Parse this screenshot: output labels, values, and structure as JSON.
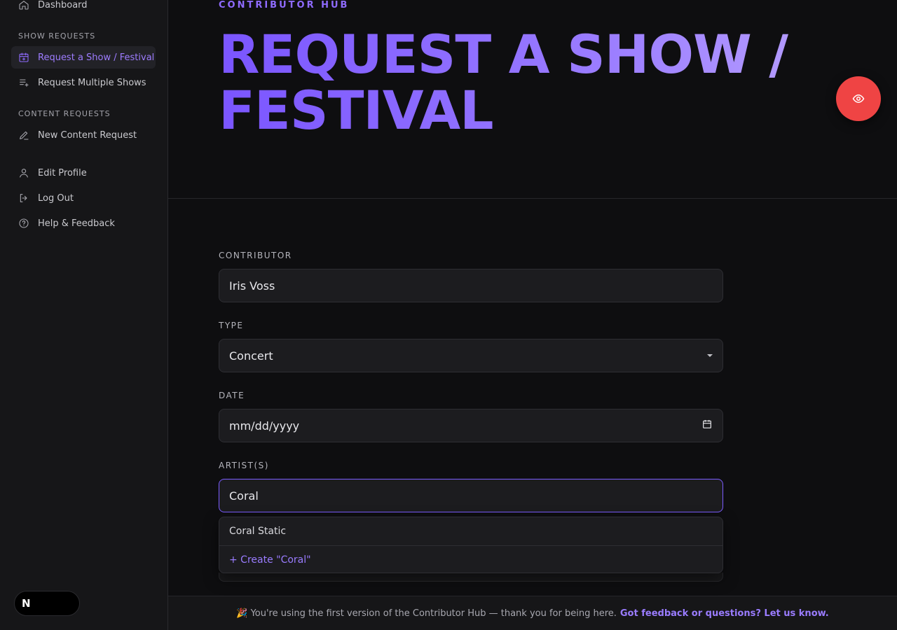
{
  "sidebar": {
    "dashboard": "Dashboard",
    "show_requests_label": "SHOW REQUESTS",
    "request_show": "Request a Show / Festival",
    "request_multiple": "Request Multiple Shows",
    "content_requests_label": "CONTENT REQUESTS",
    "new_content": "New Content Request",
    "edit_profile": "Edit Profile",
    "log_out": "Log Out",
    "help": "Help & Feedback"
  },
  "header": {
    "eyebrow": "CONTRIBUTOR HUB",
    "title": "REQUEST A SHOW / FESTIVAL"
  },
  "form": {
    "contributor_label": "CONTRIBUTOR",
    "contributor_value": "Iris Voss",
    "type_label": "TYPE",
    "type_value": "Concert",
    "date_label": "DATE",
    "date_placeholder": "mm/dd/yyyy",
    "artists_label": "ARTIST(S)",
    "artists_value": "Coral"
  },
  "autocomplete": {
    "option": "Coral Static",
    "create": "+ Create \"Coral\""
  },
  "footer": {
    "message": "🎉 You're using the first version of the Contributor Hub — thank you for being here.",
    "link": "Got feedback or questions? Let us know."
  },
  "badge": {
    "letter": "N"
  },
  "colors": {
    "accent": "#8f6bff",
    "fab": "#ef4444",
    "background": "#0e0e10"
  }
}
